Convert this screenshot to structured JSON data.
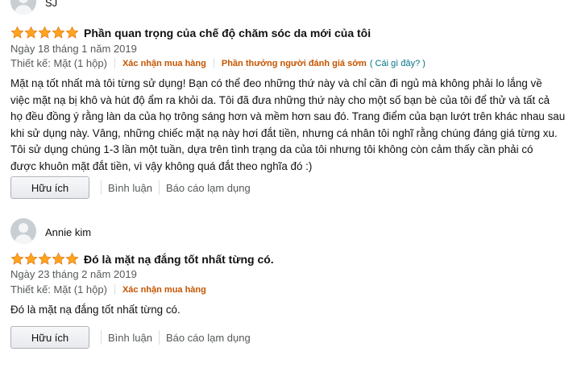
{
  "reviews": [
    {
      "reviewer": "SJ",
      "title": "Phần quan trọng của chế độ chăm sóc da mới của tôi",
      "rating": 5,
      "date": "Ngày 18 tháng 1 năm 2019",
      "variant": "Thiết kế: Mặt (1 hộp)",
      "verified": "Xác nhận mua hàng",
      "vine": "Phần thưởng người đánh giá sớm",
      "vine_q": "( Cái gì đây? )",
      "lines": [
        "Mặt nạ tốt nhất mà tôi từng sử dụng! Bạn có thể đeo những thứ này và chỉ cần đi ngủ mà không phải lo lắng về",
        "việc mặt nạ bị khô và hút độ ẩm ra khỏi da. Tôi đã đưa những thứ này cho một số bạn bè của tôi để thử và tất cả",
        "họ đều đồng ý rằng làn da của họ trông sáng hơn và mềm hơn sau đó. Trang điểm của bạn lướt trên khác nhau sau",
        "khi sử dụng này. Vâng, những chiếc mặt nạ này hơi đắt tiền, nhưng cá nhân tôi nghĩ rằng chúng đáng giá từng xu.",
        "Tôi sử dụng chúng 1-3 lần một tuần, dựa trên tình trạng da của tôi nhưng tôi không còn cảm thấy cần phải có",
        "được khuôn mặt đắt tiền, vì vậy không quá đắt theo nghĩa đó :)"
      ],
      "helpful": "Hữu ích",
      "comment": "Bình luận",
      "report": "Báo cáo lạm dụng"
    },
    {
      "reviewer": "Annie kim",
      "title": "Đó là mặt nạ đắng tốt nhất từng có.",
      "rating": 5,
      "date": "Ngày 23 tháng 2 năm 2019",
      "variant": "Thiết kế: Mặt (1 hộp)",
      "verified": "Xác nhận mua hàng",
      "lines": [
        "Đó là mặt nạ đắng tốt nhất từng có."
      ],
      "helpful": "Hữu ích",
      "comment": "Bình luận",
      "report": "Báo cáo lạm dụng"
    }
  ],
  "colors": {
    "star": "#ffa41c",
    "verified": "#c45500",
    "link": "#007185",
    "muted": "#565959"
  }
}
